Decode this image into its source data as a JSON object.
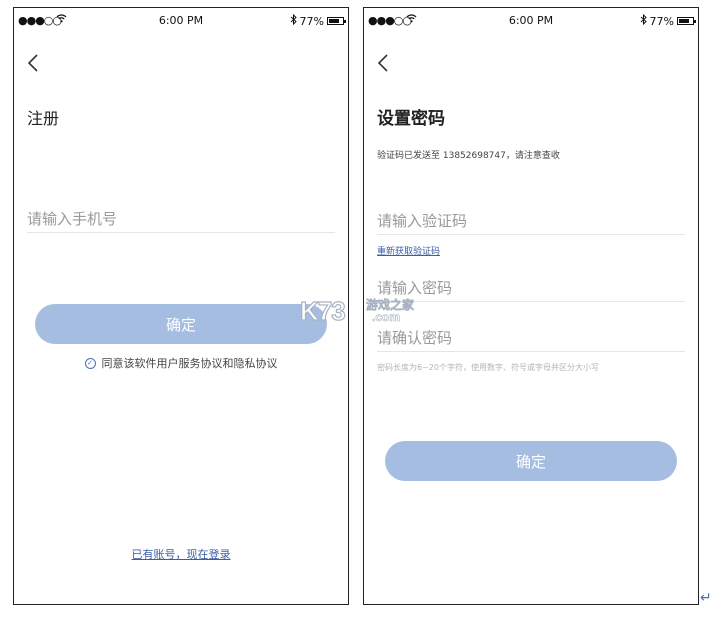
{
  "status_bar": {
    "carrier": "●●●○○",
    "time": "6:00 PM",
    "battery": "77%"
  },
  "register_screen": {
    "title": "注册",
    "phone_placeholder": "请输入手机号",
    "confirm_label": "确定",
    "agreement_text": "同意该软件用户服务协议和隐私协议",
    "login_link": "已有账号，现在登录"
  },
  "password_screen": {
    "title": "设置密码",
    "code_sent_text": "验证码已发送至 13852698747，请注意查收",
    "code_placeholder": "请输入验证码",
    "resend_link": "重新获取验证码",
    "password_placeholder": "请输入密码",
    "confirm_password_placeholder": "请确认密码",
    "password_hint": "密码长度为6~20个字符，使用数字、符号或字母并区分大小写",
    "confirm_label": "确定"
  },
  "watermark": {
    "logo": "K73",
    "site_text": "游戏之家",
    "domain": ".com"
  },
  "colors": {
    "button": "#a5bde0",
    "link": "#3b5ea8",
    "placeholder": "#999999"
  },
  "icons": {
    "back": "chevron-left-icon",
    "check": "check-circle-icon",
    "wifi": "wifi-icon",
    "bluetooth": "bluetooth-icon",
    "battery": "battery-icon"
  }
}
